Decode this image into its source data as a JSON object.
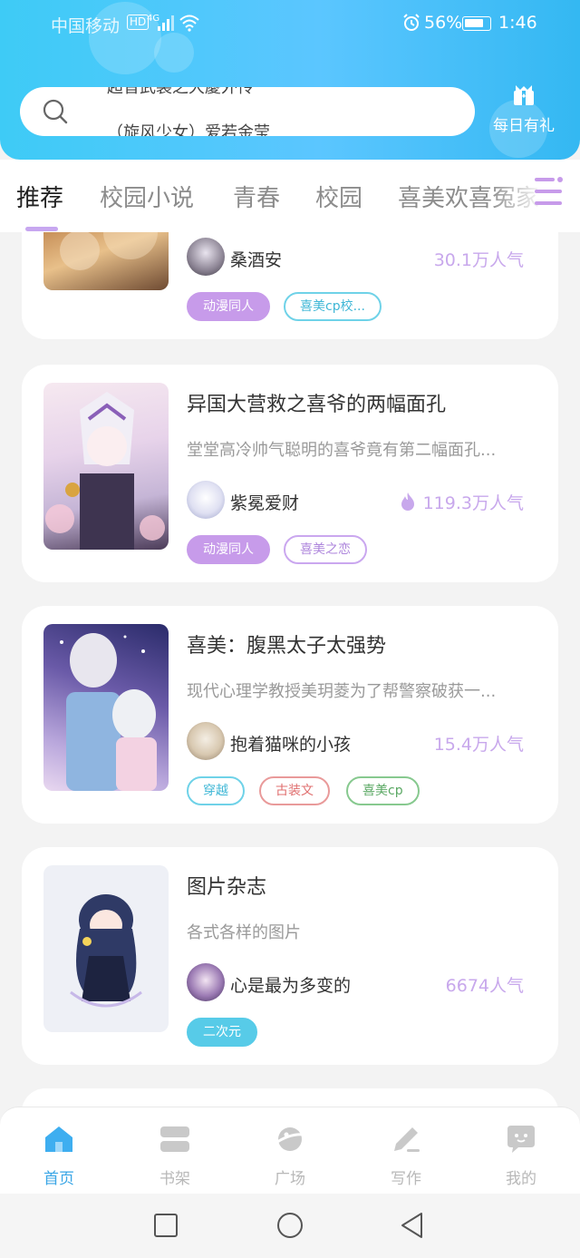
{
  "status_bar": {
    "carrier": "中国移动",
    "hd": "HD",
    "signal_type": "4G",
    "battery_percent": "56%",
    "time": "1:46"
  },
  "search": {
    "hint_line1": "超音武装之大慶外传",
    "hint_line2": "（旋风少女）爱若金莹",
    "icon": "search-icon"
  },
  "daily_gift": {
    "label": "每日有礼",
    "icon": "gift-icon"
  },
  "tabs": [
    {
      "label": "推荐",
      "active": true
    },
    {
      "label": "校园小说",
      "active": false
    },
    {
      "label": "青春",
      "active": false
    },
    {
      "label": "校园",
      "active": false
    },
    {
      "label": "喜美欢喜冤家",
      "active": false
    }
  ],
  "books": [
    {
      "title": "",
      "description": "",
      "author": "桑酒安",
      "popularity": "30.1万人气",
      "hot": false,
      "tags": [
        {
          "label": "动漫同人",
          "style": "fill-purple"
        },
        {
          "label": "喜美cp校...",
          "style": "o-cyan"
        }
      ]
    },
    {
      "title": "异国大营救之喜爷的两幅面孔",
      "description": "堂堂高冷帅气聪明的喜爷竟有第二幅面孔...",
      "author": "紫冕爱财",
      "popularity": "119.3万人气",
      "hot": true,
      "tags": [
        {
          "label": "动漫同人",
          "style": "fill-purple"
        },
        {
          "label": "喜美之恋",
          "style": "o-purple"
        }
      ]
    },
    {
      "title": "喜美：腹黑太子太强势",
      "description": "现代心理学教授美玥菱为了帮警察破获一...",
      "author": "抱着猫咪的小孩",
      "popularity": "15.4万人气",
      "hot": false,
      "tags": [
        {
          "label": "穿越",
          "style": "o-cyan"
        },
        {
          "label": "古装文",
          "style": "o-red"
        },
        {
          "label": "喜美cp",
          "style": "o-green"
        }
      ]
    },
    {
      "title": "图片杂志",
      "description": "各式各样的图片",
      "author": "心是最为多变的",
      "popularity": "6674人气",
      "hot": false,
      "tags": [
        {
          "label": "二次元",
          "style": "fill-cyan"
        }
      ]
    }
  ],
  "bottom_nav": [
    {
      "label": "首页",
      "icon": "home-icon",
      "active": true
    },
    {
      "label": "书架",
      "icon": "bookshelf-icon",
      "active": false
    },
    {
      "label": "广场",
      "icon": "planet-icon",
      "active": false
    },
    {
      "label": "写作",
      "icon": "pen-icon",
      "active": false
    },
    {
      "label": "我的",
      "icon": "chat-bubble-icon",
      "active": false
    }
  ],
  "colors": {
    "header_gradient_start": "#3ecbf6",
    "header_gradient_end": "#34b8f2",
    "accent_purple": "#c79bea",
    "active_nav_blue": "#3aa6e6"
  }
}
